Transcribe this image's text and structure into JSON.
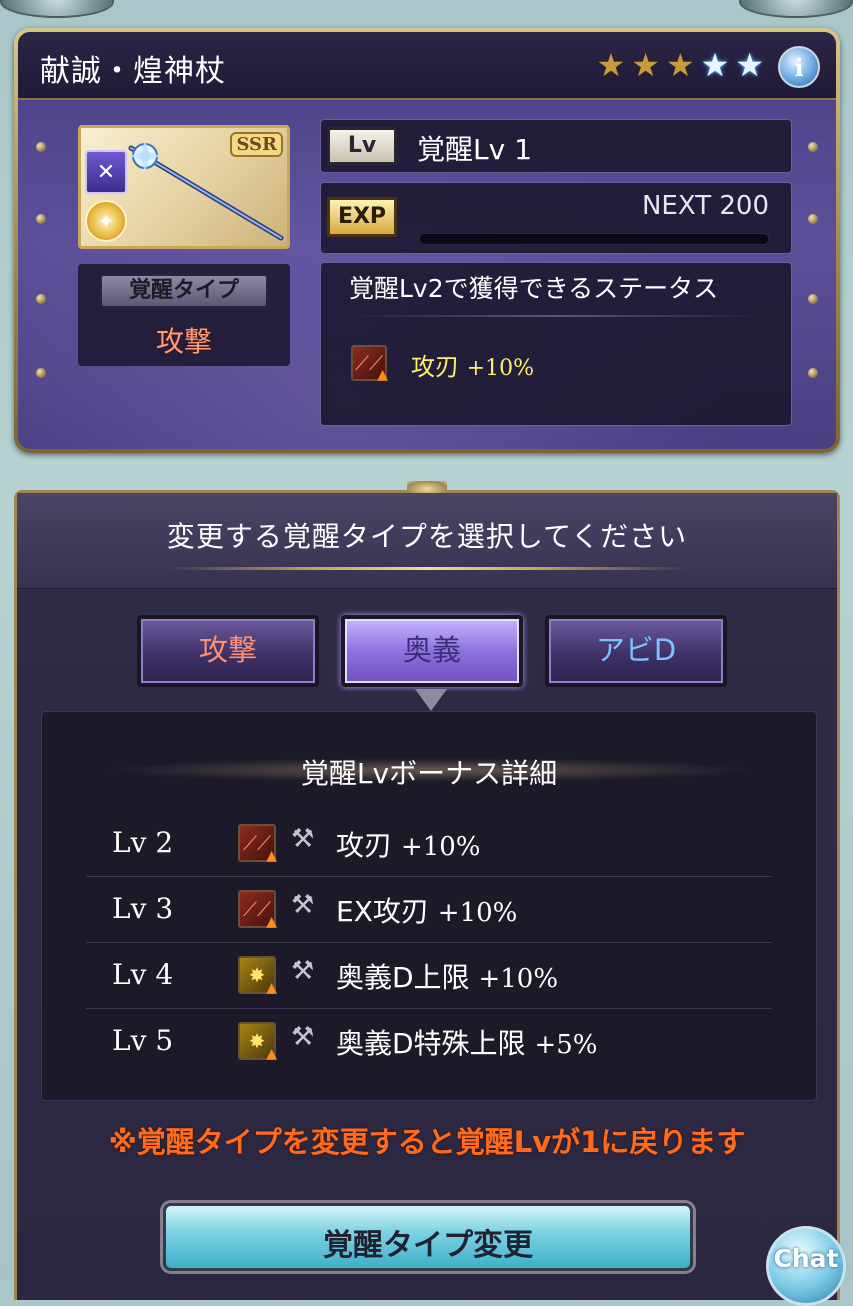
{
  "weapon": {
    "name": "献誠・煌神杖",
    "stars": [
      "gold",
      "gold",
      "gold",
      "blue",
      "blue"
    ],
    "rarity_badge": "SSR",
    "info_icon": "i",
    "level_tag": "Lv",
    "level_value": "覚醒Lv 1",
    "exp_tag": "EXP",
    "exp_next": "NEXT 200",
    "exp_progress": 0,
    "awaken_type_label": "覚醒タイプ",
    "awaken_type_value": "攻撃",
    "next_status_title": "覚醒Lv2で獲得できるステータス",
    "next_status_effect_name": "攻刃",
    "next_status_effect_value": "+10%"
  },
  "select": {
    "title": "変更する覚醒タイプを選択してください",
    "tabs": [
      {
        "label": "攻撃",
        "active": false
      },
      {
        "label": "奥義",
        "active": true
      },
      {
        "label": "アビD",
        "active": false
      }
    ],
    "bonus_title": "覚醒Lvボーナス詳細",
    "bonus_rows": [
      {
        "level": "Lv 2",
        "name": "攻刃",
        "value": "+10%",
        "icon": "sword-up-icon"
      },
      {
        "level": "Lv 3",
        "name": "EX攻刃",
        "value": "+10%",
        "icon": "sword-up-icon"
      },
      {
        "level": "Lv 4",
        "name": "奥義D上限",
        "value": "+10%",
        "icon": "ougi-up-icon"
      },
      {
        "level": "Lv 5",
        "name": "奥義D特殊上限",
        "value": "+5%",
        "icon": "ougi-up-icon"
      }
    ],
    "warning": "※覚醒タイプを変更すると覚醒Lvが1に戻ります",
    "change_button": "覚醒タイプ変更"
  },
  "chat_button": "Chat",
  "colors": {
    "panel_purple": "#5c4f9a",
    "gold_frame": "#a08650",
    "attack_text": "#ff8f73",
    "warning": "#ff6b1e",
    "effect_yellow": "#fff06a"
  }
}
